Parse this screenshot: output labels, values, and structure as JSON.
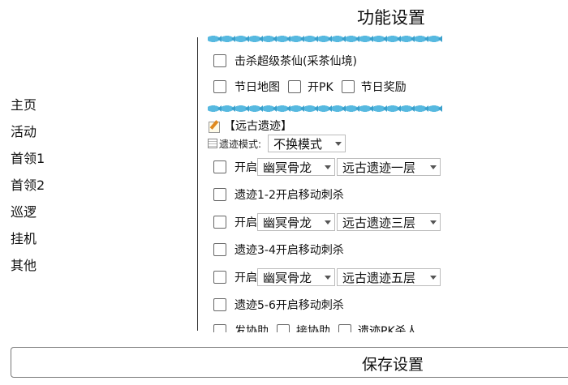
{
  "title": "功能设置",
  "nav": [
    "主页",
    "活动",
    "首领1",
    "首领2",
    "巡逻",
    "挂机",
    "其他"
  ],
  "panel": {
    "kill_tea": "击杀超级茶仙(采茶仙境)",
    "holiday_map": "节日地图",
    "open_pk": "开PK",
    "holiday_reward": "节日奖励",
    "section_title": "【远古遗迹】",
    "mode_label": "遗迹模式:",
    "mode_value": "不换模式",
    "open_label": "开启",
    "boss_1": "幽冥骨龙",
    "floor_1": "远古遗迹一层",
    "move_kill_12": "遗迹1-2开启移动刺杀",
    "boss_2": "幽冥骨龙",
    "floor_2": "远古遗迹三层",
    "move_kill_34": "遗迹3-4开启移动刺杀",
    "boss_3": "幽冥骨龙",
    "floor_3": "远古遗迹五层",
    "move_kill_56": "遗迹5-6开启移动刺杀",
    "assist_send": "发协助",
    "assist_accept": "接协助",
    "pk_kill": "遗迹PK杀人"
  },
  "save_label": "保存设置"
}
